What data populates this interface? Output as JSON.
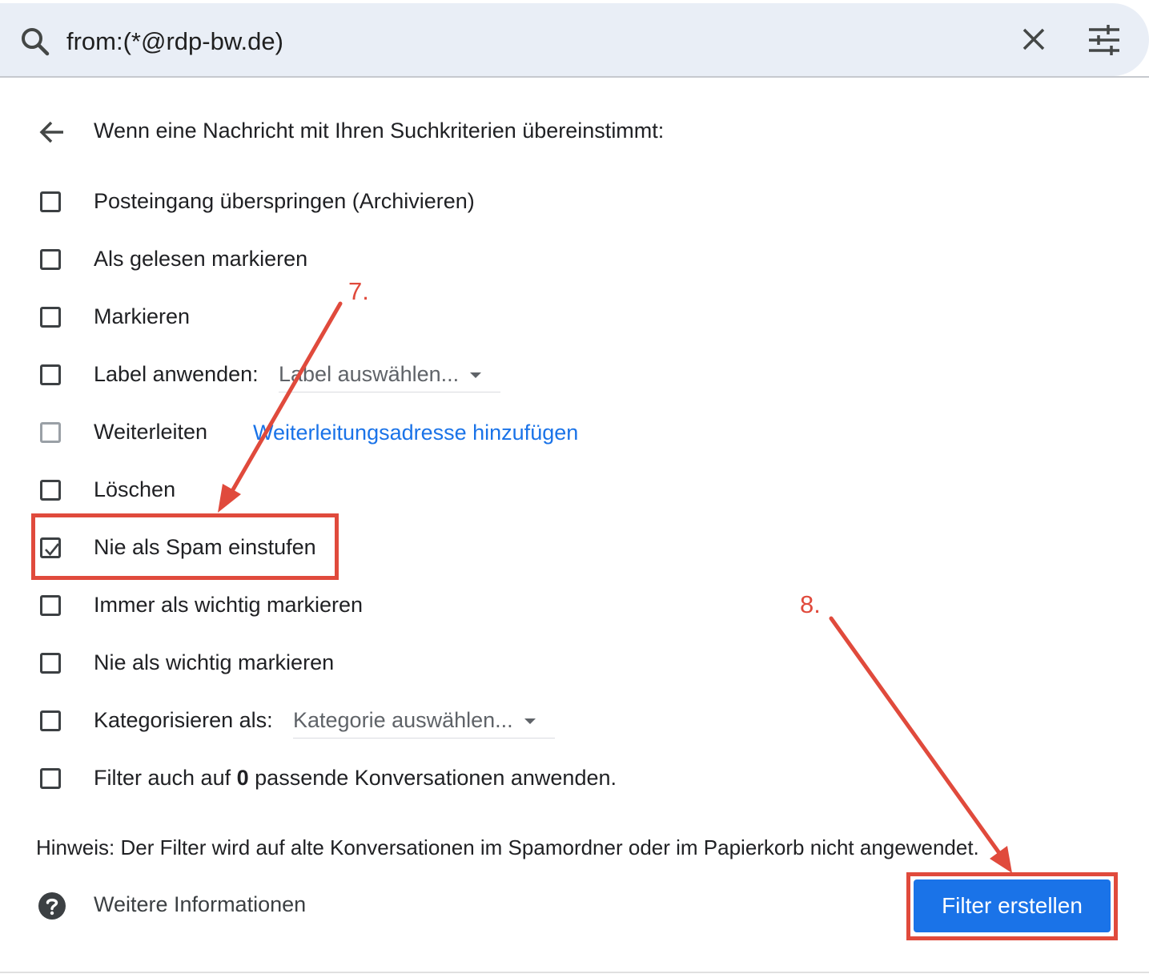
{
  "search": {
    "query": "from:(*@rdp-bw.de)",
    "search_icon": "search-icon",
    "clear_icon": "close-icon",
    "options_icon": "tune-icon"
  },
  "header": {
    "back_icon": "arrow-back-icon",
    "title": "Wenn eine Nachricht mit Ihren Suchkriterien übereinstimmt:"
  },
  "options": [
    {
      "label": "Posteingang überspringen (Archivieren)",
      "checked": false
    },
    {
      "label": "Als gelesen markieren",
      "checked": false
    },
    {
      "label": "Markieren",
      "checked": false
    },
    {
      "label": "Label anwenden:",
      "checked": false,
      "select": "Label auswählen..."
    },
    {
      "label": "Weiterleiten",
      "checked": false,
      "disabled": true,
      "link": "Weiterleitungsadresse hinzufügen"
    },
    {
      "label": "Löschen",
      "checked": false
    },
    {
      "label": "Nie als Spam einstufen",
      "checked": true
    },
    {
      "label": "Immer als wichtig markieren",
      "checked": false
    },
    {
      "label": "Nie als wichtig markieren",
      "checked": false
    },
    {
      "label": "Kategorisieren als:",
      "checked": false,
      "select": "Kategorie auswählen..."
    },
    {
      "label_pre": "Filter auch auf",
      "count": "0",
      "label_post": "passende Konversationen anwenden.",
      "checked": false
    }
  ],
  "hint": "Hinweis: Der Filter wird auf alte Konversationen im Spamordner oder im Papierkorb nicht angewendet.",
  "footer": {
    "help_icon": "help-icon",
    "more_info": "Weitere Informationen",
    "create_button": "Filter erstellen"
  },
  "annotations": {
    "step7": "7.",
    "step8": "8.",
    "color": "#e04a3c"
  },
  "colors": {
    "accent": "#1a73e8",
    "searchbar_bg": "#e9eef6"
  }
}
